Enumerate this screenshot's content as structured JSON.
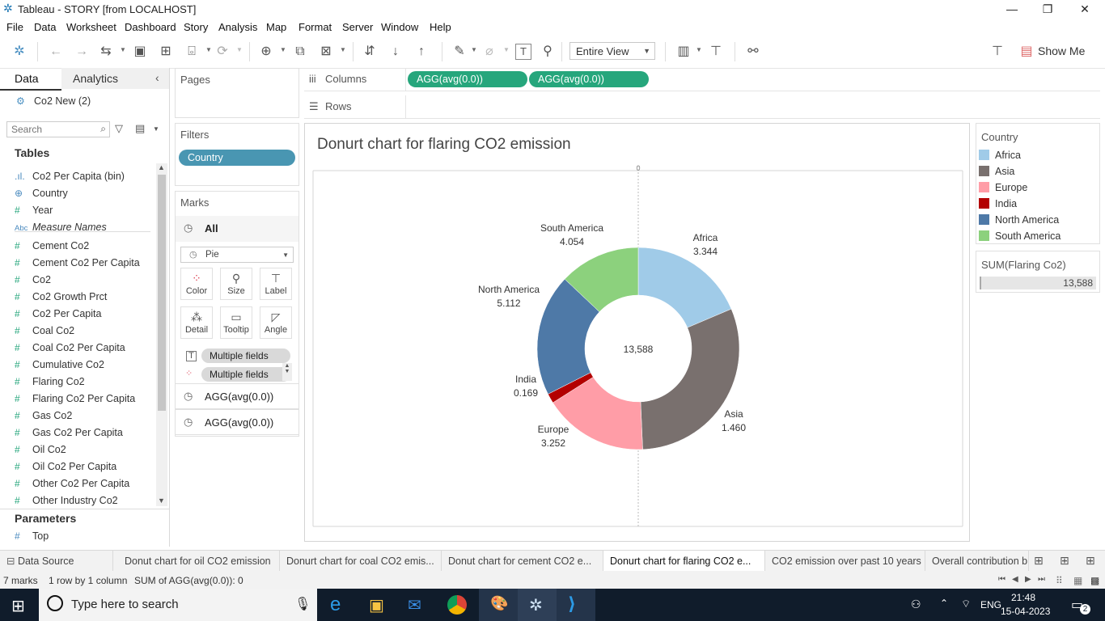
{
  "window": {
    "title": "Tableau - STORY [from LOCALHOST]",
    "minimize": "—",
    "restore": "❐",
    "close": "✕"
  },
  "menu": [
    "File",
    "Data",
    "Worksheet",
    "Dashboard",
    "Story",
    "Analysis",
    "Map",
    "Format",
    "Server",
    "Window",
    "Help"
  ],
  "toolbar": {
    "fit_value": "Entire View",
    "show_me_label": "Show Me"
  },
  "data_pane": {
    "tabs": [
      "Data",
      "Analytics"
    ],
    "datasource": "Co2 New (2)",
    "search_placeholder": "Search",
    "tables_header": "Tables",
    "fields": [
      {
        "icon": ".ıl.",
        "label": "Co2 Per Capita (bin)"
      },
      {
        "icon": "⊕",
        "label": "Country"
      },
      {
        "icon": "#",
        "label": "Year"
      },
      {
        "icon": "Abc",
        "label": "Measure Names"
      },
      {
        "icon": "#",
        "label": "Cement Co2"
      },
      {
        "icon": "#",
        "label": "Cement Co2 Per Capita"
      },
      {
        "icon": "#",
        "label": "Co2"
      },
      {
        "icon": "#",
        "label": "Co2 Growth Prct"
      },
      {
        "icon": "#",
        "label": "Co2 Per Capita"
      },
      {
        "icon": "#",
        "label": "Coal Co2"
      },
      {
        "icon": "#",
        "label": "Coal Co2 Per Capita"
      },
      {
        "icon": "#",
        "label": "Cumulative Co2"
      },
      {
        "icon": "#",
        "label": "Flaring Co2"
      },
      {
        "icon": "#",
        "label": "Flaring Co2 Per Capita"
      },
      {
        "icon": "#",
        "label": "Gas Co2"
      },
      {
        "icon": "#",
        "label": "Gas Co2 Per Capita"
      },
      {
        "icon": "#",
        "label": "Oil Co2"
      },
      {
        "icon": "#",
        "label": "Oil Co2 Per Capita"
      },
      {
        "icon": "#",
        "label": "Other Co2 Per Capita"
      },
      {
        "icon": "#",
        "label": "Other Industry Co2"
      }
    ],
    "parameters_header": "Parameters",
    "parameters": [
      {
        "icon": "#",
        "label": "Top"
      }
    ]
  },
  "shelves": {
    "pages": "Pages",
    "filters": "Filters",
    "filter_pill": "Country",
    "columns": "Columns",
    "rows": "Rows",
    "column_pills": [
      "AGG(avg(0.0))",
      "AGG(avg(0.0))"
    ]
  },
  "marks": {
    "title": "Marks",
    "all": "All",
    "mark_type": "Pie",
    "buttons": [
      "Color",
      "Size",
      "Label",
      "Detail",
      "Tooltip",
      "Angle"
    ],
    "field_pills": [
      "Multiple fields",
      "Multiple fields"
    ],
    "agg_rows": [
      "AGG(avg(0.0))",
      "AGG(avg(0.0))"
    ]
  },
  "chart_data": {
    "type": "pie",
    "title": "Donurt chart for flaring CO2 emission",
    "center_label": "13,588",
    "axis_tick": "0",
    "categories": [
      "Africa",
      "Asia",
      "Europe",
      "India",
      "North America",
      "South America"
    ],
    "labels": [
      "3.344",
      "1.460",
      "3.252",
      "0.169",
      "5.112",
      "4.054"
    ],
    "shares": [
      0.186,
      0.307,
      0.167,
      0.0155,
      0.195,
      0.1295
    ],
    "colors": [
      "#a0cbe8",
      "#79706e",
      "#ff9da7",
      "#b30000",
      "#4e79a7",
      "#8cd17d"
    ]
  },
  "legend": {
    "title": "Country",
    "items": [
      {
        "label": "Africa",
        "color": "#a0cbe8"
      },
      {
        "label": "Asia",
        "color": "#79706e"
      },
      {
        "label": "Europe",
        "color": "#ff9da7"
      },
      {
        "label": "India",
        "color": "#b30000"
      },
      {
        "label": "North America",
        "color": "#4e79a7"
      },
      {
        "label": "South America",
        "color": "#8cd17d"
      }
    ],
    "size_title": "SUM(Flaring Co2)",
    "size_value": "13,588"
  },
  "sheet_tabs": {
    "data_source": "Data Source",
    "tabs": [
      "Donut chart for oil CO2 emission",
      "Donurt chart for coal CO2 emis...",
      "Donut chart for cement CO2 e...",
      "Donurt chart for flaring CO2 e...",
      "CO2 emission over past 10 years",
      "Overall contribution b"
    ],
    "active_index": 3
  },
  "status": {
    "marks": "7 marks",
    "rows_cols": "1 row by 1 column",
    "sum": "SUM of AGG(avg(0.0)): 0"
  },
  "taskbar": {
    "search_placeholder": "Type here to search",
    "lang": "ENG",
    "time": "21:48",
    "date": "15-04-2023",
    "notifications": "2"
  }
}
